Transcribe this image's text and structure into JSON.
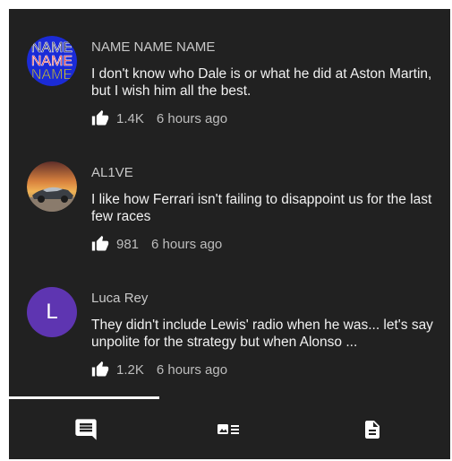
{
  "comments": [
    {
      "author": "NAME NAME NAME",
      "text": "I don't know who Dale is or what he did at Aston Martin, but I wish him all the best.",
      "likes": "1.4K",
      "time": "6 hours ago",
      "avatar": {
        "type": "text-logo",
        "lines": [
          "NAME",
          "NAME",
          "NAME"
        ],
        "colors": [
          "#1b2bd6",
          "#e11d1d",
          "#e9d80e"
        ]
      }
    },
    {
      "author": "AL1VE",
      "text": "I like how Ferrari isn't failing to disappoint us for the last few races",
      "likes": "981",
      "time": "6 hours ago",
      "avatar": {
        "type": "image",
        "description": "car-at-sunset"
      }
    },
    {
      "author": "Luca Rey",
      "text": "They didn't include Lewis' radio when he was... let's say unpolite  for the strategy but when Alonso ...",
      "likes": "1.2K",
      "time": "6 hours ago",
      "avatar": {
        "type": "initial",
        "letter": "L",
        "color": "#5e35b1"
      }
    }
  ],
  "tabs": [
    {
      "icon": "comment-icon",
      "selected": true
    },
    {
      "icon": "media-list-icon",
      "selected": false
    },
    {
      "icon": "document-icon",
      "selected": false
    }
  ],
  "colors": {
    "background": "#212121",
    "text": "#f1f1f1",
    "secondary": "#bdbdbd",
    "indicator": "#ffffff"
  }
}
